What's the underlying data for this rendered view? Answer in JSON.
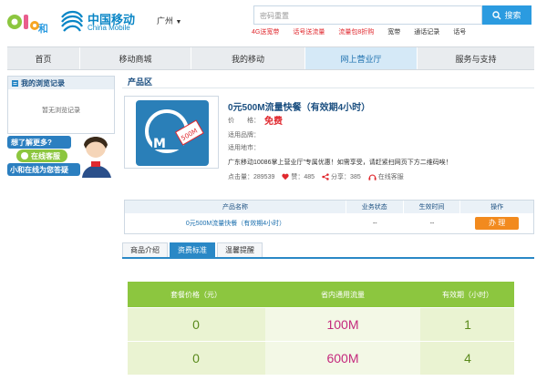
{
  "header": {
    "logo_and_text": "and和",
    "brand_cn": "中国移动",
    "brand_en": "China Mobile",
    "city": "广州",
    "search_placeholder": "密码重置",
    "search_button": "搜索",
    "hot_links": [
      {
        "label": "4G送宽带",
        "highlight": true
      },
      {
        "label": "话号送流量",
        "highlight": true
      },
      {
        "label": "流量包8折购",
        "highlight": true
      },
      {
        "label": "宽带",
        "highlight": false
      },
      {
        "label": "通话记录",
        "highlight": false
      },
      {
        "label": "话号",
        "highlight": false
      }
    ]
  },
  "nav": {
    "items": [
      "首页",
      "移动商城",
      "我的移动",
      "网上营业厅",
      "服务与支持"
    ],
    "active_index": 3
  },
  "sidebar": {
    "history_title": "我的浏览记录",
    "history_empty": "暂无浏览记录",
    "service_banner": {
      "line1": "想了解更多?",
      "button": "在线客服",
      "line2": "小和在线为您答疑"
    }
  },
  "product_area": {
    "section_title": "产品区",
    "image_label": "500M",
    "name": "0元500M流量快餐（有效期4小时）",
    "price_label": "价　　格：",
    "price_value": "免费",
    "brand_label": "适用品牌：",
    "region_label": "适用地市：",
    "promo": "广东移动10086掌上营业厅”专属优惠！如需享受，请赶紧扫网页下方二维码唉！",
    "stats": {
      "clicks": "点击量：289539",
      "likes": "赞：485",
      "shares": "分享：385",
      "service": "在线客服"
    }
  },
  "order_table": {
    "headers": [
      "产品名称",
      "业务状态",
      "生效时间",
      "操作"
    ],
    "row": {
      "name": "0元500M流量快餐（有效期4小时）",
      "status": "--",
      "effective": "--",
      "action": "办 理"
    }
  },
  "tabs": {
    "items": [
      "商品介绍",
      "资费标准",
      "温馨提醒"
    ],
    "active_index": 1
  },
  "pricing": {
    "headers": [
      "套餐价格（元）",
      "省内通用流量",
      "有效期（小时）"
    ],
    "rows": [
      [
        "0",
        "100M",
        "1"
      ],
      [
        "0",
        "600M",
        "4"
      ]
    ]
  },
  "colors": {
    "brand_blue": "#0a86c6",
    "accent_red": "#e0282e",
    "order_orange": "#f28a1e",
    "price_green": "#8cc63f"
  }
}
